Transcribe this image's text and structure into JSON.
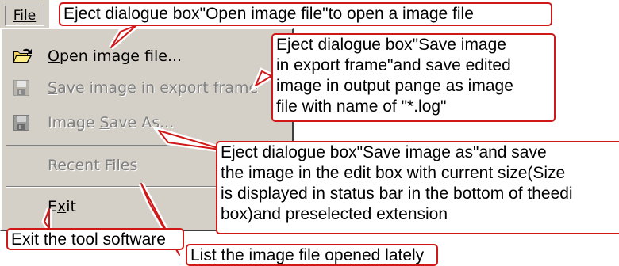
{
  "menu": {
    "title": "File",
    "title_accel": "F",
    "title_rest": "ile",
    "items": [
      {
        "accel": "O",
        "rest": "pen image file...",
        "state": "enabled",
        "icon": "open-folder-icon"
      },
      {
        "accel": "S",
        "rest": "ave image in export frame",
        "state": "disabled",
        "icon": "floppy-disk-icon"
      },
      {
        "pre": "Image ",
        "accel": "S",
        "rest": "ave As...",
        "state": "disabled",
        "icon": "floppy-disk-icon"
      },
      {
        "label": "Recent Files",
        "state": "disabled"
      },
      {
        "pre": "E",
        "accel": "x",
        "rest": "it",
        "state": "enabled"
      }
    ]
  },
  "callouts": {
    "file": "Eject  dialogue box\"Open image file\"to open a image file",
    "export": [
      "Eject dialogue box\"Save image",
      "in export frame\"and save edited",
      "image in output pange as image",
      "file with name of \"*.log\""
    ],
    "saveas": [
      "Eject dialogue box\"Save image as\"and save",
      "the image in the edit box with current size(Size",
      "is displayed in status bar in the bottom of theedi",
      "box)and preselected extension"
    ],
    "exit": "Exit the tool software",
    "recent": "List the image file opened lately"
  },
  "colors": {
    "menu_bg": "#d4d0c8",
    "callout_border": "#d01818",
    "disabled_text": "#808080"
  }
}
